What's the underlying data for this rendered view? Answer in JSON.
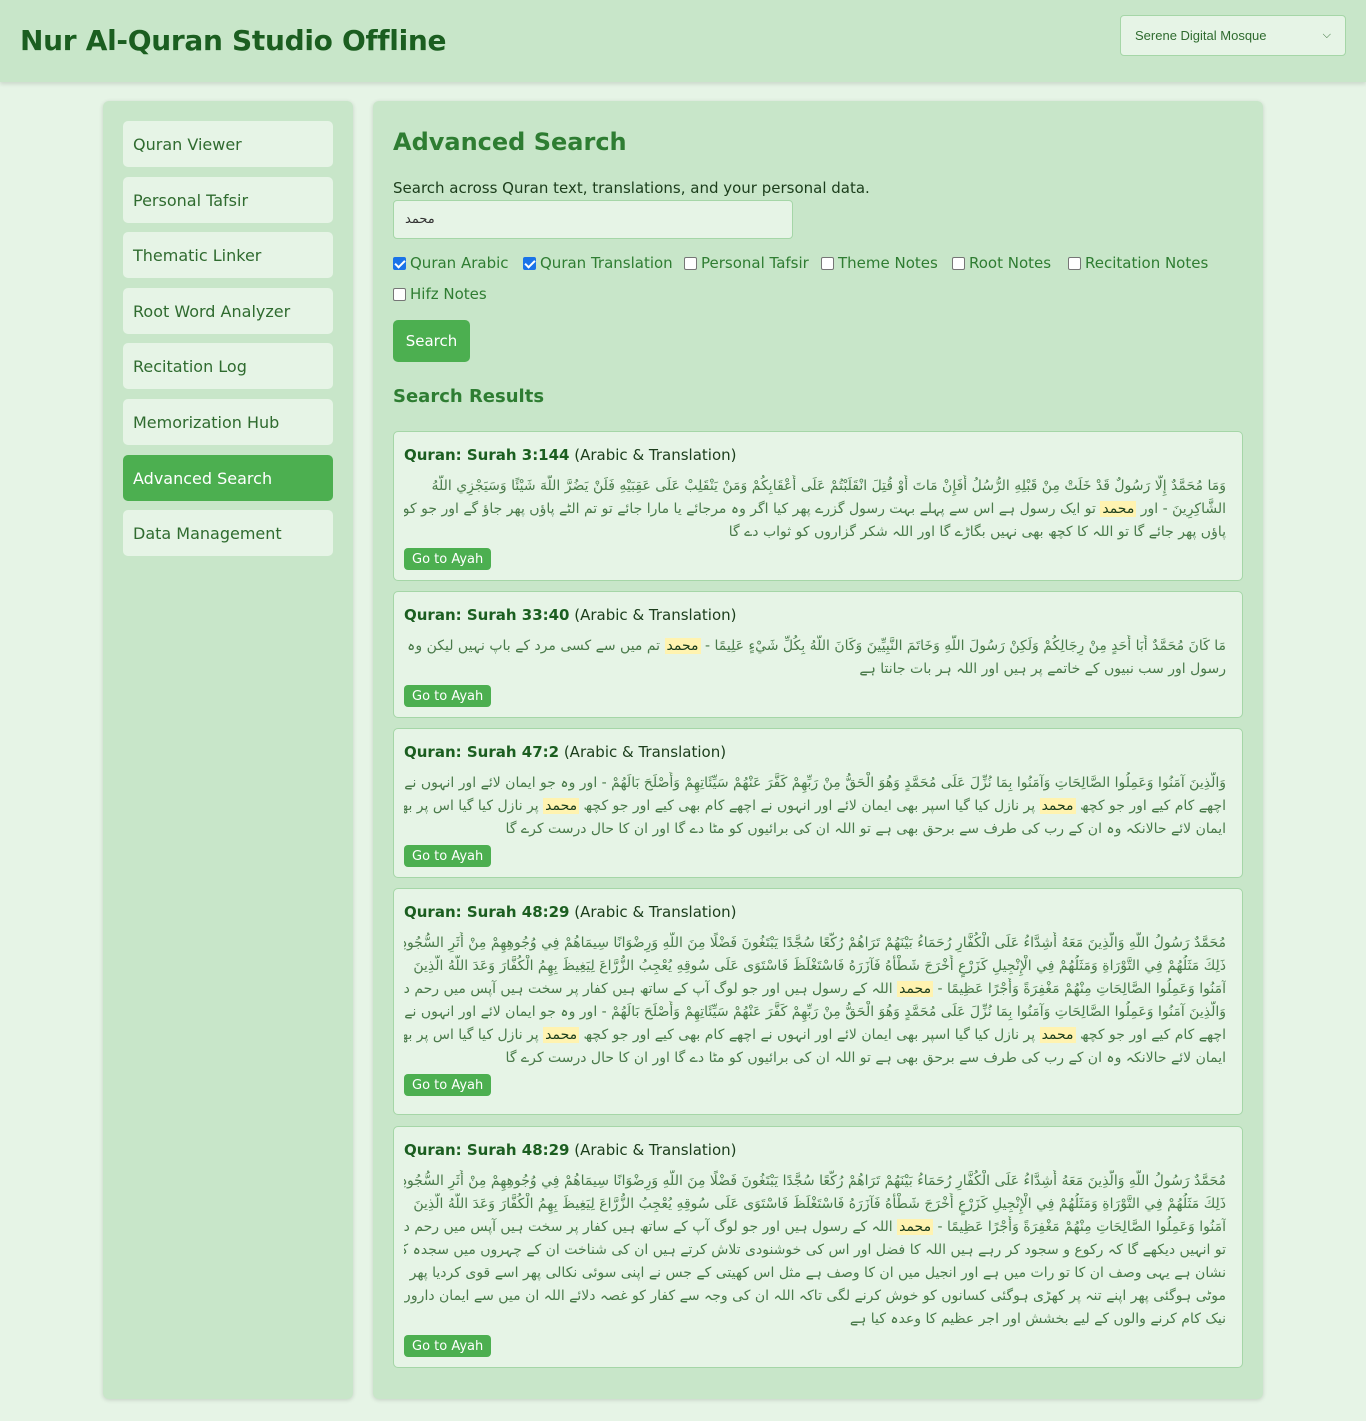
{
  "app": {
    "title": "Nur Al-Quran Studio Offline",
    "theme_selected": "Serene Digital Mosque"
  },
  "sidebar": {
    "items": [
      {
        "label": "Quran Viewer"
      },
      {
        "label": "Personal Tafsir"
      },
      {
        "label": "Thematic Linker"
      },
      {
        "label": "Root Word Analyzer"
      },
      {
        "label": "Recitation Log"
      },
      {
        "label": "Memorization Hub"
      },
      {
        "label": "Advanced Search",
        "active": true
      },
      {
        "label": "Data Management"
      }
    ]
  },
  "search": {
    "heading": "Advanced Search",
    "description": "Search across Quran text, translations, and your personal data.",
    "query": "محمد",
    "filters": [
      {
        "label": "Quran Arabic",
        "checked": true
      },
      {
        "label": "Quran Translation",
        "checked": true
      },
      {
        "label": "Personal Tafsir",
        "checked": false
      },
      {
        "label": "Theme Notes",
        "checked": false
      },
      {
        "label": "Root Notes",
        "checked": false
      },
      {
        "label": "Recitation Notes",
        "checked": false
      },
      {
        "label": "Hifz Notes",
        "checked": false
      }
    ],
    "button_label": "Search"
  },
  "results": {
    "heading": "Search Results",
    "goto_label": "Go to Ayah",
    "items": [
      {
        "ref": "Quran: Surah 3:144",
        "type": "(Arabic & Translation)",
        "lines": [
          [
            "وَمَا مُحَمَّدٌ إِلَّا رَسُولٌ قَدْ خَلَتْ مِنْ قَبْلِهِ الرُّسُلُ أَفَإِنْ مَاتَ أَوْ قُتِلَ انْقَلَبْتُمْ عَلَى أَعْقَابِكُمْ وَمَنْ يَنْقَلِبْ عَلَى عَقِبَيْهِ فَلَنْ يَضُرَّ اللَّهَ شَيْئًا وَسَيَجْزِي اللَّهُ"
          ],
          [
            "الشَّاكِرِينَ - اور ",
            "محمد",
            " تو ایک رسول ہے اس سے پہلے بہت رسول گزرے پھر کیا اگر وہ مرجائے یا مارا جائے تو تم الٹے پاؤں پھر جاؤ گے اور جو کوئی الٹے"
          ],
          [
            "پاؤں پھر جائے گا تو اللہ کا کچھ بھی نہیں بگاڑے گا اور اللہ شکر گزاروں کو ثواب دے گا"
          ]
        ]
      },
      {
        "ref": "Quran: Surah 33:40",
        "type": "(Arabic & Translation)",
        "lines": [
          [
            "مَا كَانَ مُحَمَّدٌ أَبَا أَحَدٍ مِنْ رِجَالِكُمْ وَلَكِنْ رَسُولَ اللَّهِ وَخَاتَمَ النَّبِيِّينَ وَكَانَ اللَّهُ بِكُلِّ شَيْءٍ عَلِيمًا - ",
            "محمد",
            " تم میں سے کسی مرد کے باپ نہیں لیکن وہ اللہ کے"
          ],
          [
            "رسول اور سب نبیوں کے خاتمے پر ہیں اور اللہ ہر بات جانتا ہے"
          ]
        ]
      },
      {
        "ref": "Quran: Surah 47:2",
        "type": "(Arabic & Translation)",
        "lines": [
          [
            "وَالَّذِينَ آمَنُوا وَعَمِلُوا الصَّالِحَاتِ وَآمَنُوا بِمَا نُزِّلَ عَلَى مُحَمَّدٍ وَهُوَ الْحَقُّ مِنْ رَبِّهِمْ كَفَّرَ عَنْهُمْ سَيِّئَاتِهِمْ وَأَصْلَحَ بَالَهُمْ - اور وہ جو ایمان لائے اور انہوں نے"
          ],
          [
            "اچھے کام کیے اور جو کچھ ",
            "محمد",
            " پر نازل کیا گیا اسپر بھی ایمان لائے اور انہوں نے اچھے کام بھی کیے اور جو کچھ ",
            "محمد",
            " پر نازل کیا گیا اس پر بھی"
          ],
          [
            "ایمان لائے حالانکہ وہ ان کے رب کی طرف سے برحق بھی ہے تو اللہ ان کی برائیوں کو مٹا دے گا اور ان کا حال درست کرے گا"
          ]
        ]
      },
      {
        "ref": "Quran: Surah 48:29",
        "type": "(Arabic & Translation)",
        "lines": [
          [
            "مُحَمَّدٌ رَسُولُ اللَّهِ وَالَّذِينَ مَعَهُ أَشِدَّاءُ عَلَى الْكُفَّارِ رُحَمَاءُ بَيْنَهُمْ تَرَاهُمْ رُكَّعًا سُجَّدًا يَبْتَغُونَ فَضْلًا مِنَ اللَّهِ وَرِضْوَانًا سِيمَاهُمْ فِي وُجُوهِهِمْ مِنْ أَثَرِ السُّجُودِ"
          ],
          [
            "ذَلِكَ مَثَلُهُمْ فِي التَّوْرَاةِ وَمَثَلُهُمْ فِي الْإِنْجِيلِ كَزَرْعٍ أَخْرَجَ شَطْأَهُ فَآزَرَهُ فَاسْتَغْلَظَ فَاسْتَوَى عَلَى سُوقِهِ يُعْجِبُ الزُّرَّاعَ لِيَغِيظَ بِهِمُ الْكُفَّارَ وَعَدَ اللَّهُ الَّذِينَ"
          ],
          [
            "آمَنُوا وَعَمِلُوا الصَّالِحَاتِ مِنْهُمْ مَغْفِرَةً وَأَجْرًا عَظِيمًا - ",
            "محمد",
            " اللہ کے رسول ہیں اور جو لوگ آپ کے ساتھ ہیں کفار پر سخت ہیں آپس میں رحم دل ہیں"
          ],
          [
            "وَالَّذِينَ آمَنُوا وَعَمِلُوا الصَّالِحَاتِ وَآمَنُوا بِمَا نُزِّلَ عَلَى مُحَمَّدٍ وَهُوَ الْحَقُّ مِنْ رَبِّهِمْ كَفَّرَ عَنْهُمْ سَيِّئَاتِهِمْ وَأَصْلَحَ بَالَهُمْ - اور وہ جو ایمان لائے اور انہوں نے"
          ],
          [
            "اچھے کام کیے اور جو کچھ ",
            "محمد",
            " پر نازل کیا گیا اسپر بھی ایمان لائے اور انہوں نے اچھے کام بھی کیے اور جو کچھ ",
            "محمد",
            " پر نازل کیا گیا اس پر بھی"
          ],
          [
            "ایمان لائے حالانکہ وہ ان کے رب کی طرف سے برحق بھی ہے تو اللہ ان کی برائیوں کو مٹا دے گا اور ان کا حال درست کرے گا"
          ]
        ]
      },
      {
        "ref": "Quran: Surah 48:29",
        "type": "(Arabic & Translation)",
        "lines": [
          [
            "مُحَمَّدٌ رَسُولُ اللَّهِ وَالَّذِينَ مَعَهُ أَشِدَّاءُ عَلَى الْكُفَّارِ رُحَمَاءُ بَيْنَهُمْ تَرَاهُمْ رُكَّعًا سُجَّدًا يَبْتَغُونَ فَضْلًا مِنَ اللَّهِ وَرِضْوَانًا سِيمَاهُمْ فِي وُجُوهِهِمْ مِنْ أَثَرِ السُّجُودِ"
          ],
          [
            "ذَلِكَ مَثَلُهُمْ فِي التَّوْرَاةِ وَمَثَلُهُمْ فِي الْإِنْجِيلِ كَزَرْعٍ أَخْرَجَ شَطْأَهُ فَآزَرَهُ فَاسْتَغْلَظَ فَاسْتَوَى عَلَى سُوقِهِ يُعْجِبُ الزُّرَّاعَ لِيَغِيظَ بِهِمُ الْكُفَّارَ وَعَدَ اللَّهُ الَّذِينَ"
          ],
          [
            "آمَنُوا وَعَمِلُوا الصَّالِحَاتِ مِنْهُمْ مَغْفِرَةً وَأَجْرًا عَظِيمًا - ",
            "محمد",
            " اللہ کے رسول ہیں اور جو لوگ آپ کے ساتھ ہیں کفار پر سخت ہیں آپس میں رحم دل ہیں"
          ],
          [
            "تو انہیں دیکھے گا کہ رکوع و سجود کر رہے ہیں اللہ کا فضل اور اس کی خوشنودی تلاش کرتے ہیں ان کی شناخت ان کے چہروں میں سجدہ کا"
          ],
          [
            "نشان ہے یہی وصف ان کا تو رات میں ہے اور انجیل میں ان کا وصف ہے مثل اس کھیتی کے جس نے اپنی سوئی نکالی پھر اسے قوی کردیا پھر"
          ],
          [
            "موٹی ہوگئی پھر اپنے تنہ پر کھڑی ہوگئی کسانوں کو خوش کرنے لگی تاکہ اللہ ان کی وجہ سے کفار کو غصہ دلائے اللہ ان میں سے ایمان داروں اور"
          ],
          [
            "نیک کام کرنے والوں کے لیے بخشش اور اجر عظیم کا وعدہ کیا ہے"
          ]
        ]
      }
    ]
  }
}
